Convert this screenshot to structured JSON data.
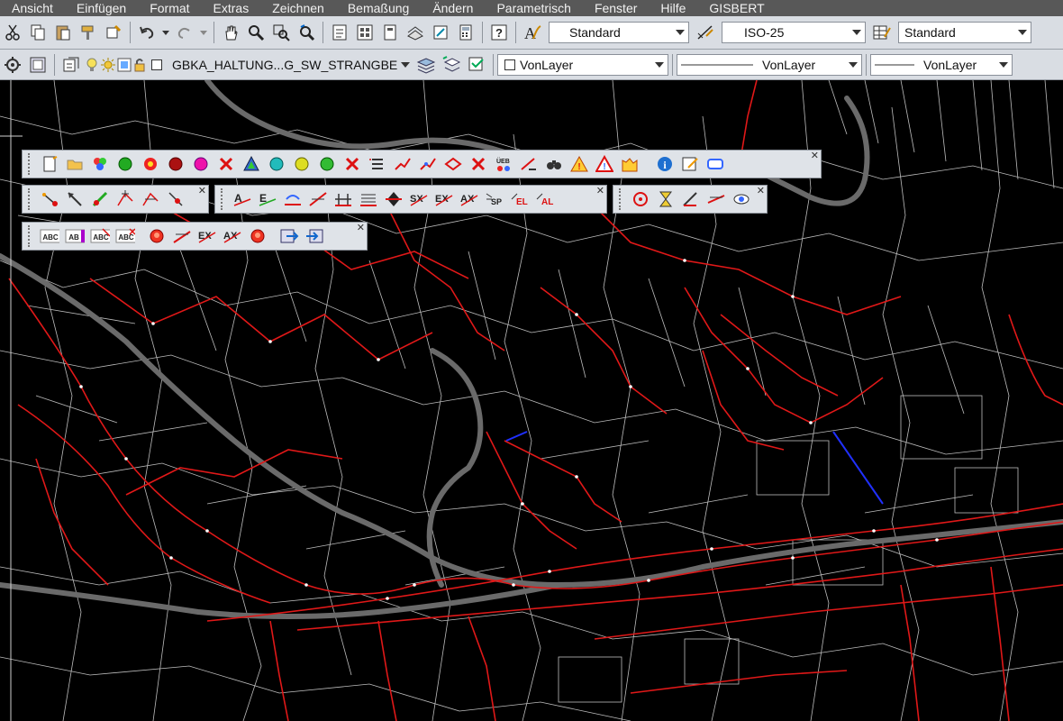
{
  "menu": [
    "Ansicht",
    "Einfügen",
    "Format",
    "Extras",
    "Zeichnen",
    "Bemaßung",
    "Ändern",
    "Parametrisch",
    "Fenster",
    "Hilfe",
    "GISBERT"
  ],
  "toolbar1": {
    "text_style": "Standard",
    "dim_style": "ISO-25",
    "table_style": "Standard"
  },
  "toolbar2": {
    "layer_name": "GBKA_HALTUNG...G_SW_STRANGBE",
    "color": "VonLayer",
    "linetype": "VonLayer",
    "lineweight": "VonLayer"
  },
  "icons": {
    "toolbar1": [
      "cut-icon",
      "copy-icon",
      "paste-icon",
      "match-properties-icon",
      "block-editor-icon",
      "undo-icon",
      "redo-icon",
      "pan-icon",
      "zoom-realtime-icon",
      "zoom-window-icon",
      "zoom-previous-icon",
      "properties-icon",
      "design-center-icon",
      "tool-palettes-icon",
      "sheet-set-icon",
      "markup-icon",
      "calculator-icon",
      "help-icon",
      "text-style-icon",
      "dim-style-icon",
      "table-style-icon"
    ],
    "toolbar2": [
      "workspace-settings-icon",
      "layer-properties-icon",
      "layer-state-icon",
      "layer-freeze-icon",
      "layer-lock-icon"
    ],
    "floating1": [
      "new-object-icon",
      "open-folder-icon",
      "layer-filter-icon",
      "green-dot-icon",
      "red-yellow-dot-icon",
      "dark-red-dot-icon",
      "magenta-dot-icon",
      "red-x-icon",
      "triangle-icon",
      "cyan-dot-icon",
      "yellow-dot-icon",
      "green-dot-2-icon",
      "red-x-2-icon",
      "list-icon",
      "polyline-icon",
      "polyline-edit-icon",
      "node-icon",
      "delete-red-x-icon",
      "ueb-icon",
      "edit-line-icon",
      "binoculars-icon",
      "warning-icon",
      "warning-2-icon",
      "chart-icon",
      "info-icon",
      "edit-form-icon",
      "window-icon"
    ],
    "floating2a": [
      "node-connect-icon",
      "arrow-line-icon",
      "pencil-line-icon",
      "vertex-add-icon",
      "vertex-move-icon",
      "vertex-delete-icon"
    ],
    "floating2b": [
      "label-a-icon",
      "label-e-icon",
      "rotate-icon",
      "line-red-icon",
      "dimension-icon",
      "hatch-icon",
      "double-arrow-icon",
      "sx-icon",
      "ex-icon",
      "ax-icon",
      "sp-icon",
      "el-icon",
      "al-icon"
    ],
    "floating2c": [
      "target-icon",
      "hourglass-icon",
      "tool-icon",
      "line-edit-icon",
      "view-icon"
    ],
    "floating3": [
      "abc-icon",
      "abc-purple-icon",
      "abc-edit-icon",
      "abc-delete-icon",
      "red-button-icon",
      "line-cross-icon",
      "ex-2-icon",
      "ax-2-icon",
      "red-button-2-icon",
      "export-icon",
      "import-icon"
    ]
  }
}
